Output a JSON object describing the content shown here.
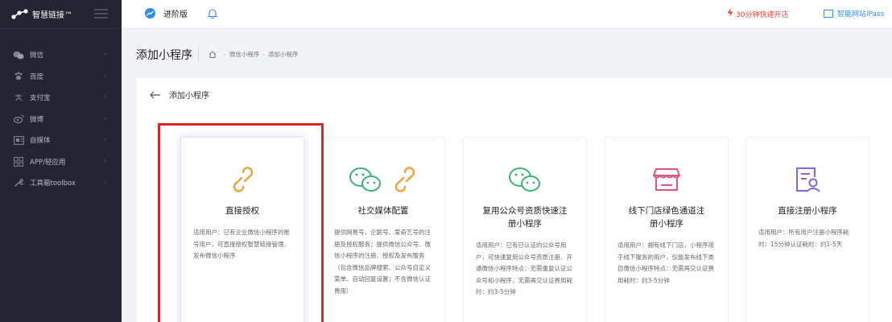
{
  "brand": {
    "name": "智慧链接™"
  },
  "sidebar": {
    "items": [
      {
        "label": "微信",
        "icon": "wechat-icon"
      },
      {
        "label": "百度",
        "icon": "paw-icon"
      },
      {
        "label": "支付宝",
        "icon": "alipay-icon"
      },
      {
        "label": "微博",
        "icon": "weibo-icon"
      },
      {
        "label": "自媒体",
        "icon": "media-icon"
      },
      {
        "label": "APP/轻应用",
        "icon": "apps-icon"
      },
      {
        "label": "工具箱toolbox",
        "icon": "wrench-icon"
      }
    ]
  },
  "topbar": {
    "edition": "进阶版",
    "promo": "30分钟快速开店",
    "ipass": "智能网站iPass"
  },
  "page": {
    "title": "添加小程序",
    "breadcrumb": [
      "微信小程序",
      "添加小程序"
    ]
  },
  "panel": {
    "back_label": "添加小程序",
    "cards": [
      {
        "title": "直接授权",
        "desc": "适用用户：已有企业微信小程序的账号用户，可直接授权智慧链接管理、发布微信小程序"
      },
      {
        "title": "社交媒体配置",
        "desc": "提供网易号、企鹅号、爱奇艺号的注册及授权服务；提供微信公众号、微信小程序的注册、授权及发布服务（包含微信品牌搜索、公众号自定义菜单、自动回复设置；不含微信认证费用）"
      },
      {
        "title": "复用公众号资质快速注册小程序",
        "desc": "适用用户：已有已认证的公众号用户，可快速复用公众号资质注册、开通微信小程序特点：无需重复认证公众号和小程序，无需再交认证费用耗时：约3-5分钟"
      },
      {
        "title": "线下门店绿色通道注册小程序",
        "desc": "适用用户：拥有线下门店，小程序用于线下服务的用户，仅能发布线下类目微信小程序特点：无需再交认证费用耗时：约3-5分钟"
      },
      {
        "title": "直接注册小程序",
        "desc": "适用用户：所有用户注册小程序耗时：15分钟认证耗时：约1-5天"
      }
    ]
  },
  "colors": {
    "sidebar_bg": "#232533",
    "accent_blue": "#2d8cf0",
    "promo_red": "#f04134",
    "highlight_red": "#d9252a",
    "icon_orange": "#f0a23a",
    "icon_green": "#3cb371",
    "icon_pink": "#e2547a",
    "icon_purple": "#7c6ad8"
  }
}
